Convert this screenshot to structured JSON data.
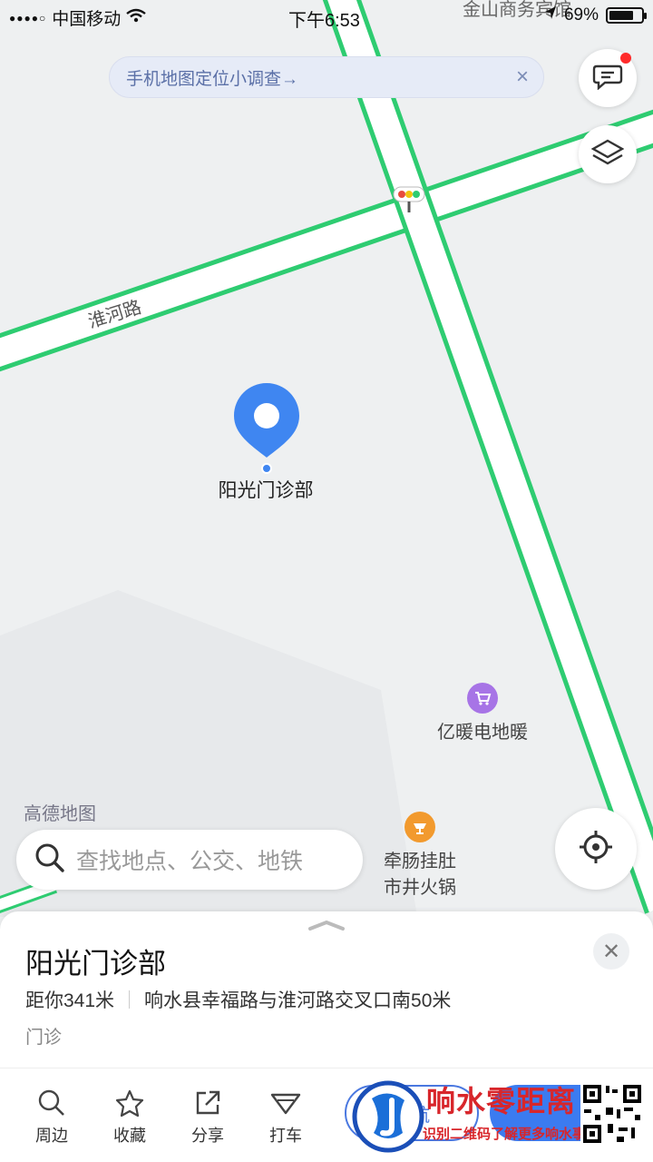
{
  "status_bar": {
    "carrier": "中国移动",
    "time": "下午6:53",
    "battery_percent": "69%",
    "battery_level": 0.69
  },
  "survey_banner": {
    "text": "手机地图定位小调查→",
    "close": "×"
  },
  "map": {
    "road_label": "淮河路",
    "top_poi": "金山商务宾馆",
    "selected_pin_label": "阳光门诊部",
    "pois": [
      {
        "name": "亿暖电地暖",
        "color": "#a774e6"
      },
      {
        "name_line1": "牵肠挂肚",
        "name_line2": "市井火锅",
        "color": "#f29a2e"
      }
    ],
    "brand": "高德地图",
    "road_color": "#2ecc71"
  },
  "search": {
    "placeholder": "查找地点、公交、地铁"
  },
  "place": {
    "title": "阳光门诊部",
    "distance": "距你341米",
    "address": "响水县幸福路与淮河路交叉口南50米",
    "category": "门诊"
  },
  "bottom_tabs": [
    {
      "label": "周边",
      "icon": "search-icon"
    },
    {
      "label": "收藏",
      "icon": "star-icon"
    },
    {
      "label": "分享",
      "icon": "share-icon"
    },
    {
      "label": "打车",
      "icon": "taxi-icon"
    }
  ],
  "actions": {
    "navigate_label": "导航",
    "accent": "#3b7bf0"
  },
  "watermark": {
    "title": "响水零距离",
    "subtitle": "识别二维码了解更多响水事"
  }
}
